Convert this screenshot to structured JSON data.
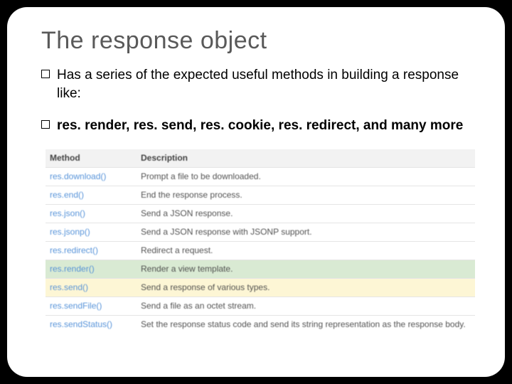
{
  "title": "The response object",
  "bullets": [
    {
      "text": "Has a series of the expected useful methods in building a response like:",
      "bold": false
    },
    {
      "text": "res. render, res. send, res. cookie, res. redirect, and many more",
      "bold": true
    }
  ],
  "table": {
    "headers": {
      "method": "Method",
      "description": "Description"
    },
    "rows": [
      {
        "method": "res.download()",
        "description": "Prompt a file to be downloaded.",
        "highlight": ""
      },
      {
        "method": "res.end()",
        "description": "End the response process.",
        "highlight": ""
      },
      {
        "method": "res.json()",
        "description": "Send a JSON response.",
        "highlight": ""
      },
      {
        "method": "res.jsonp()",
        "description": "Send a JSON response with JSONP support.",
        "highlight": ""
      },
      {
        "method": "res.redirect()",
        "description": "Redirect a request.",
        "highlight": ""
      },
      {
        "method": "res.render()",
        "description": "Render a view template.",
        "highlight": "green"
      },
      {
        "method": "res.send()",
        "description": "Send a response of various types.",
        "highlight": "yellow"
      },
      {
        "method": "res.sendFile()",
        "description": "Send a file as an octet stream.",
        "highlight": ""
      },
      {
        "method": "res.sendStatus()",
        "description": "Set the response status code and send its string representation as the response body.",
        "highlight": ""
      }
    ]
  }
}
